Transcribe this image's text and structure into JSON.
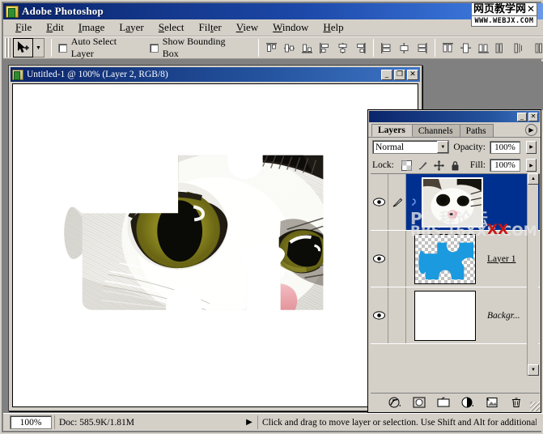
{
  "app": {
    "title": "Adobe Photoshop",
    "icon": "photoshop-icon",
    "window_buttons": [
      "minimize",
      "maximize",
      "close"
    ]
  },
  "watermark": {
    "top_text": "网页教学网",
    "close_glyph": "✕",
    "bottom_text": "WWW.WEBJX.COM"
  },
  "menubar": {
    "items": [
      {
        "label": "File",
        "accel": "F"
      },
      {
        "label": "Edit",
        "accel": "E"
      },
      {
        "label": "Image",
        "accel": "I"
      },
      {
        "label": "Layer",
        "accel": "L"
      },
      {
        "label": "Select",
        "accel": "S"
      },
      {
        "label": "Filter",
        "accel": "t"
      },
      {
        "label": "View",
        "accel": "V"
      },
      {
        "label": "Window",
        "accel": "W"
      },
      {
        "label": "Help",
        "accel": "H"
      }
    ]
  },
  "options_bar": {
    "active_tool": "move-tool",
    "tool_preset_label": "",
    "auto_select_layer": {
      "label": "Auto Select Layer",
      "checked": false
    },
    "show_bounding_box": {
      "label": "Show Bounding Box",
      "checked": false
    },
    "align_icons": [
      "align-top-edges",
      "align-vertical-centers",
      "align-bottom-edges",
      "align-left-edges",
      "align-horizontal-centers",
      "align-right-edges",
      "distribute-top-edges",
      "distribute-vertical-centers",
      "distribute-bottom-edges",
      "distribute-left-edges",
      "distribute-horizontal-centers",
      "distribute-right-edges"
    ]
  },
  "document": {
    "title": "Untitled-1 @ 100% (Layer 2, RGB/8)",
    "min_glyph": "_",
    "max_glyph": "❐",
    "close_glyph": "✕",
    "canvas_description": "white-cat-face-clipped-to-jigsaw-puzzle-piece"
  },
  "layers_panel": {
    "title_min_glyph": "_",
    "title_close_glyph": "✕",
    "tabs": [
      {
        "label": "Layers",
        "active": true
      },
      {
        "label": "Channels",
        "active": false
      },
      {
        "label": "Paths",
        "active": false
      }
    ],
    "menu_glyph": "▶",
    "blend_mode": "Normal",
    "blend_arrow": "▼",
    "opacity_label": "Opacity:",
    "opacity_value": "100%",
    "opacity_arrow": "▶",
    "lock_label": "Lock:",
    "lock_icons": [
      "lock-transparent-pixels-icon",
      "lock-image-pixels-icon",
      "lock-position-icon",
      "lock-all-icon"
    ],
    "fill_label": "Fill:",
    "fill_value": "100%",
    "fill_arrow": "▶",
    "layers": [
      {
        "name": "",
        "selected": true,
        "visible": true,
        "eye_icon": "eye-icon",
        "extra_icon": "brush-icon",
        "link_icon": "link-icon",
        "thumbnail": "cat-photo-thumbnail",
        "locked": false
      },
      {
        "name": "Layer 1",
        "selected": false,
        "visible": true,
        "eye_icon": "eye-icon",
        "extra_icon": "",
        "thumbnail": "blue-puzzle-piece-thumbnail",
        "locked": false
      },
      {
        "name": "Backgr...",
        "selected": false,
        "visible": true,
        "eye_icon": "eye-icon",
        "extra_icon": "",
        "thumbnail": "white-background-thumbnail",
        "locked": true,
        "lock_icon": "padlock-icon"
      }
    ],
    "scrollbar": {
      "up_glyph": "▲",
      "down_glyph": "▼"
    },
    "bottom_buttons": [
      "layer-style-fx-icon",
      "add-layer-mask-icon",
      "new-group-icon",
      "new-adjustment-layer-icon",
      "new-layer-icon",
      "delete-layer-icon"
    ],
    "overlay_watermark": {
      "line1": "PS 程论坛",
      "line2": "BBS.16XX8.COM",
      "red_mark": "XX"
    }
  },
  "status_bar": {
    "zoom": "100%",
    "doc_info": "Doc: 585.9K/1.81M",
    "expand_glyph": "▶",
    "message": "Click and drag to move layer or selection. Use Shift and Alt for additional options."
  },
  "colors": {
    "title_blue": "#0a246a",
    "panel_gray": "#d4d0c8",
    "selected_layer_blue": "#00308f",
    "puzzle_blue": "#1b9ae0",
    "workspace_gray": "#808080"
  }
}
